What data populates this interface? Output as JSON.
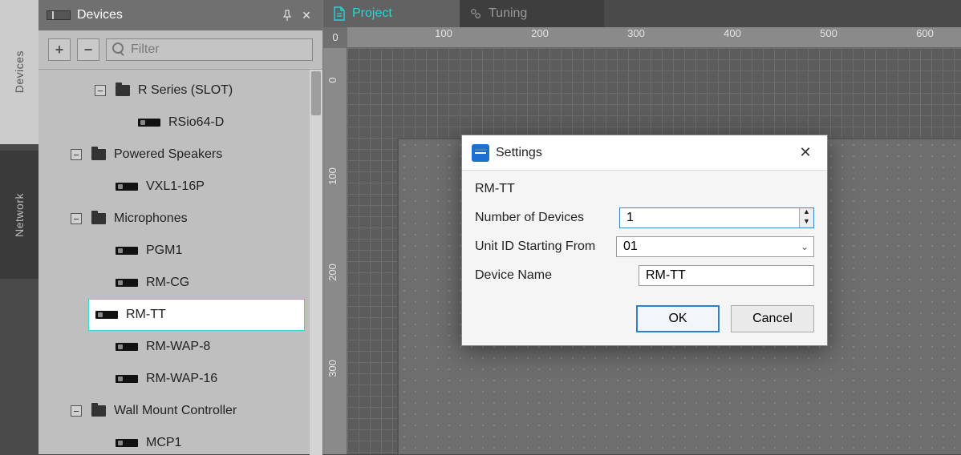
{
  "vtabs": {
    "devices": "Devices",
    "network": "Network"
  },
  "panel": {
    "title": "Devices",
    "filter_placeholder": "Filter",
    "expand_all": "+",
    "collapse_all": "−"
  },
  "tree": {
    "r_series": "R Series (SLOT)",
    "rsio": "RSio64-D",
    "powered": "Powered Speakers",
    "vxl": "VXL1-16P",
    "microphones": "Microphones",
    "pgm1": "PGM1",
    "rmcg": "RM-CG",
    "rmtt": "RM-TT",
    "rmwap8": "RM-WAP-8",
    "rmwap16": "RM-WAP-16",
    "wall": "Wall Mount Controller",
    "mcp1": "MCP1"
  },
  "tabs": {
    "project": "Project",
    "tuning": "Tuning"
  },
  "ruler": {
    "h": [
      "100",
      "200",
      "300",
      "400",
      "500",
      "600"
    ],
    "v": [
      "0",
      "100",
      "200",
      "300"
    ]
  },
  "corner": "0",
  "dialog": {
    "title": "Settings",
    "context": "RM-TT",
    "num_label": "Number of Devices",
    "num_value": "1",
    "unit_label": "Unit ID Starting From",
    "unit_value": "01",
    "name_label": "Device Name",
    "name_value": "RM-TT",
    "ok": "OK",
    "cancel": "Cancel"
  }
}
